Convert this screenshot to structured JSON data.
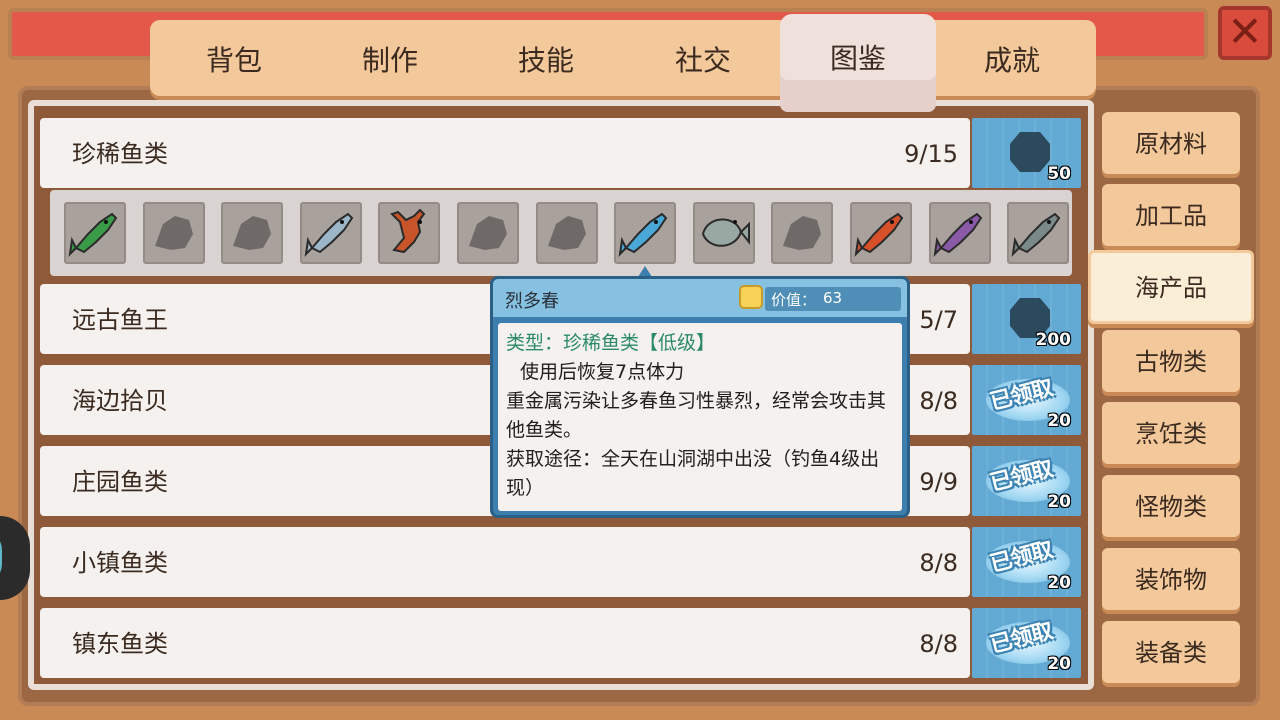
{
  "tabs": [
    {
      "label": "背包"
    },
    {
      "label": "制作"
    },
    {
      "label": "技能"
    },
    {
      "label": "社交"
    },
    {
      "label": "图鉴",
      "active": true
    },
    {
      "label": "成就"
    }
  ],
  "categories": [
    {
      "label": "原材料"
    },
    {
      "label": "加工品"
    },
    {
      "label": "海产品",
      "active": true
    },
    {
      "label": "古物类"
    },
    {
      "label": "烹饪类"
    },
    {
      "label": "怪物类"
    },
    {
      "label": "装饰物"
    },
    {
      "label": "装备类"
    }
  ],
  "collections": [
    {
      "name": "珍稀鱼类",
      "count": "9/15",
      "reward": "50",
      "claimed": false
    },
    {
      "name": "远古鱼王",
      "count": "5/7",
      "reward": "200",
      "claimed": false
    },
    {
      "name": "海边拾贝",
      "count": "8/8",
      "reward": "20",
      "claimed": true
    },
    {
      "name": "庄园鱼类",
      "count": "9/9",
      "reward": "20",
      "claimed": true
    },
    {
      "name": "小镇鱼类",
      "count": "8/8",
      "reward": "20",
      "claimed": true
    },
    {
      "name": "镇东鱼类",
      "count": "8/8",
      "reward": "20",
      "claimed": true
    }
  ],
  "claimed_label": "已领取",
  "fish_slots": [
    {
      "icon": "green-fish-icon",
      "discovered": true,
      "color": "#3a9b48"
    },
    {
      "icon": "unknown-silhouette-icon",
      "discovered": false
    },
    {
      "icon": "unknown-silhouette-icon",
      "discovered": false
    },
    {
      "icon": "silver-fish-icon",
      "discovered": true,
      "color": "#9bb6c8"
    },
    {
      "icon": "lobster-icon",
      "discovered": true,
      "color": "#c8552a"
    },
    {
      "icon": "unknown-silhouette-icon",
      "discovered": false
    },
    {
      "icon": "unknown-silhouette-icon",
      "discovered": false
    },
    {
      "icon": "blue-fish-icon",
      "discovered": true,
      "color": "#4aa8d8"
    },
    {
      "icon": "round-fish-icon",
      "discovered": true,
      "color": "#9aa8a4"
    },
    {
      "icon": "unknown-silhouette-icon",
      "discovered": false
    },
    {
      "icon": "red-fish-icon",
      "discovered": true,
      "color": "#d8502a"
    },
    {
      "icon": "purple-fish-icon",
      "discovered": true,
      "color": "#8a5aa8"
    },
    {
      "icon": "gray-fish-icon",
      "discovered": true,
      "color": "#7a8a88"
    }
  ],
  "tooltip": {
    "name": "烈多春",
    "price_label": "价值：",
    "price": "63",
    "type": "类型：珍稀鱼类【低级】",
    "effect": "使用后恢复7点体力",
    "description": "重金属污染让多春鱼习性暴烈，经常会攻击其他鱼类。",
    "source": "获取途径：全天在山洞湖中出没（钓鱼4级出现）"
  },
  "colors": {
    "accent_blue": "#62aad3",
    "tab_bg": "#f3c89a",
    "close_red": "#d94c3c"
  }
}
